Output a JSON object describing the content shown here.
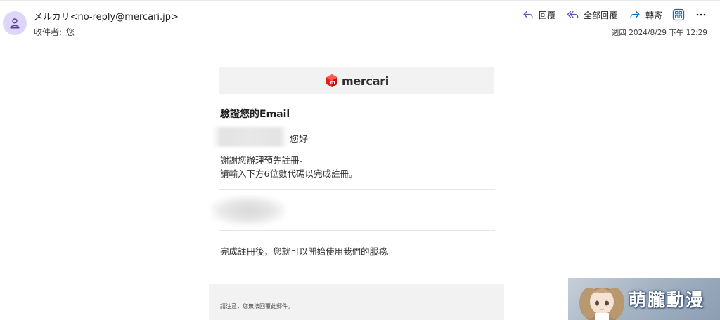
{
  "header": {
    "sender": "メルカリ<no-reply@mercari.jp>",
    "recipient_label": "收件者:",
    "recipient_value": "您",
    "date": "週四 2024/8/29 下午 12:29",
    "actions": {
      "reply": "回覆",
      "reply_all": "全部回覆",
      "forward": "轉寄"
    },
    "icons": [
      "person-icon",
      "reply-icon",
      "reply-all-icon",
      "forward-icon",
      "apps-grid-icon",
      "more-icon"
    ]
  },
  "email": {
    "logo_text": "mercari",
    "title": "驗證您的Email",
    "greeting": "您好",
    "lines": [
      "謝謝您辦理預先註冊。",
      "請輸入下方6位數代碼以完成註冊。"
    ],
    "completion": "完成註冊後，您就可以開始使用我們的服務。",
    "footer_note": "請注意，您無法回覆此郵件。"
  },
  "watermark": {
    "text": "萌朧動漫"
  },
  "colors": {
    "accent": "#6b4fbb",
    "forward": "#0f6cbd",
    "avatar_bg": "#ddd6f6",
    "logo_red": "#e2231a"
  }
}
